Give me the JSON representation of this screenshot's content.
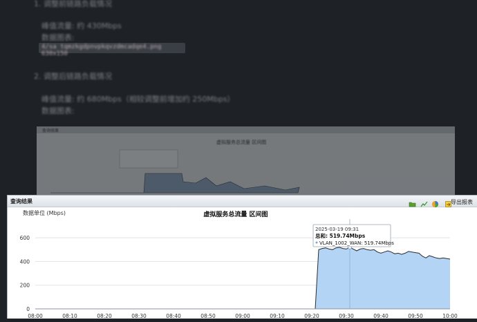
{
  "background_doc": {
    "item1_heading": "1. 调整前链路负载情况",
    "item1_peak": "峰值流量: 约 430Mbps",
    "item1_chart_label": "数据图表:",
    "item1_code": "4/sa  tqmzkgdpnvpkqvzdmcadqe4.png  630x150",
    "item2_heading": "2. 调整后链路负载情况",
    "item2_peak": "峰值流量: 约 680Mbps（相较调整前增加约 250Mbps）",
    "item2_chart_label": "数据图表:"
  },
  "background_window": {
    "tag": "查询结果",
    "title": "虚拟服务总流量 区间图"
  },
  "window": {
    "title": "查询结果",
    "toolbar": {
      "icons": [
        "folder-icon",
        "line-chart-icon",
        "pie-chart-icon",
        "export-icon"
      ],
      "export_label": "导出报表"
    },
    "colors": {
      "area_fill": "#b3d4f5",
      "line": "#2b2b2b",
      "marker": "#7fa8cf"
    }
  },
  "chart_data": {
    "type": "area",
    "title": "虚拟服务总流量 区间图",
    "ylabel": "数据单位 (Mbps)",
    "xlabel": "",
    "ylim": [
      0,
      700
    ],
    "yticks": [
      0,
      200,
      400,
      600
    ],
    "xticks": [
      "08:00",
      "08:10",
      "08:20",
      "08:30",
      "08:40",
      "08:50",
      "09:00",
      "09:10",
      "09:20",
      "09:30",
      "09:40",
      "09:50",
      "10:00"
    ],
    "x": [
      "08:00",
      "09:21",
      "09:22",
      "09:23",
      "09:24",
      "09:25",
      "09:26",
      "09:27",
      "09:28",
      "09:29",
      "09:30",
      "09:31",
      "09:32",
      "09:33",
      "09:34",
      "09:35",
      "09:36",
      "09:37",
      "09:38",
      "09:39",
      "09:40",
      "09:41",
      "09:42",
      "09:43",
      "09:44",
      "09:45",
      "09:46",
      "09:47",
      "09:48",
      "09:49",
      "09:50",
      "09:51",
      "09:52",
      "09:53",
      "09:54",
      "09:55",
      "09:56",
      "09:57",
      "09:58",
      "09:59",
      "10:00"
    ],
    "series": [
      {
        "name": "VLAN_1002_WAN",
        "values": [
          0,
          0,
          500,
          510,
          515,
          505,
          500,
          515,
          520,
          510,
          505,
          520,
          505,
          490,
          505,
          510,
          500,
          495,
          500,
          480,
          470,
          480,
          490,
          480,
          465,
          470,
          460,
          470,
          485,
          480,
          475,
          470,
          445,
          430,
          450,
          440,
          430,
          425,
          430,
          425,
          420
        ]
      }
    ],
    "tooltip": {
      "time": "2025-03-19 09:31",
      "total": "总和: 519.74Mbps",
      "series_line": "VLAN_1002_WAN: 519.74Mbps",
      "index": 11
    },
    "grid": true,
    "legend": "none"
  }
}
